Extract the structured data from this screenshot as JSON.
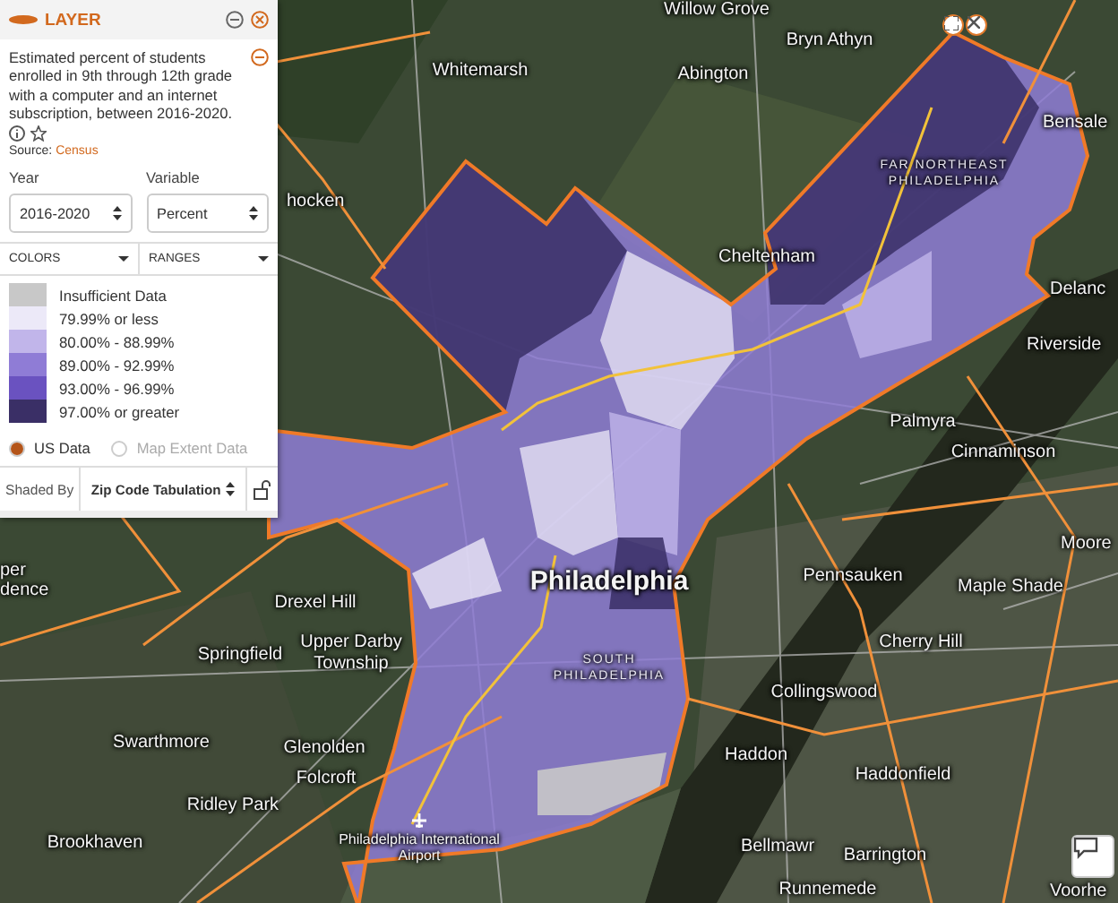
{
  "layer_panel": {
    "title": "LAYER",
    "description": "Estimated percent of students enrolled in 9th through 12th grade with a computer and an internet subscription, between 2016-2020.",
    "source_label": "Source:",
    "source_link": "Census",
    "year_label": "Year",
    "year_value": "2016-2020",
    "variable_label": "Variable",
    "variable_value": "Percent",
    "colors_menu": "COLORS",
    "ranges_menu": "RANGES",
    "legend": [
      {
        "label": "Insufficient Data",
        "color": "#c8c8c8"
      },
      {
        "label": "79.99% or less",
        "color": "#ece9f8"
      },
      {
        "label": "80.00% - 88.99%",
        "color": "#c1b5ea"
      },
      {
        "label": "89.00% - 92.99%",
        "color": "#8f7cd6"
      },
      {
        "label": "93.00% - 96.99%",
        "color": "#6a52c0"
      },
      {
        "label": "97.00% or greater",
        "color": "#3a2f66"
      }
    ],
    "data_options": [
      {
        "label": "US Data",
        "selected": true
      },
      {
        "label": "Map Extent Data",
        "selected": false
      }
    ],
    "shaded_by_label": "Shaded By",
    "shaded_by_value": "Zip Code Tabulation"
  },
  "map": {
    "labels": [
      {
        "text": "Willow Grove",
        "kind": "place"
      },
      {
        "text": "Bryn Athyn",
        "kind": "place"
      },
      {
        "text": "Whitemarsh",
        "kind": "place"
      },
      {
        "text": "Abington",
        "kind": "place"
      },
      {
        "text": "Bensale",
        "kind": "place"
      },
      {
        "text": "FAR NORTHEAST PHILADELPHIA",
        "kind": "district"
      },
      {
        "text": "hocken",
        "kind": "place"
      },
      {
        "text": "Cheltenham",
        "kind": "place"
      },
      {
        "text": "Delanc",
        "kind": "place"
      },
      {
        "text": "Riverside",
        "kind": "place"
      },
      {
        "text": "Palmyra",
        "kind": "place"
      },
      {
        "text": "Cinnaminson",
        "kind": "place"
      },
      {
        "text": "Moore",
        "kind": "place"
      },
      {
        "text": "per",
        "kind": "place"
      },
      {
        "text": "dence",
        "kind": "place"
      },
      {
        "text": "Philadelphia",
        "kind": "city"
      },
      {
        "text": "Pennsauken",
        "kind": "place"
      },
      {
        "text": "Maple Shade",
        "kind": "place"
      },
      {
        "text": "Drexel Hill",
        "kind": "place"
      },
      {
        "text": "Cherry Hill",
        "kind": "place"
      },
      {
        "text": "Springfield",
        "kind": "place"
      },
      {
        "text": "Upper Darby Township",
        "kind": "place"
      },
      {
        "text": "SOUTH PHILADELPHIA",
        "kind": "district"
      },
      {
        "text": "Collingswood",
        "kind": "place"
      },
      {
        "text": "Swarthmore",
        "kind": "place"
      },
      {
        "text": "Glenolden",
        "kind": "place"
      },
      {
        "text": "Haddon",
        "kind": "place"
      },
      {
        "text": "Haddonfield",
        "kind": "place"
      },
      {
        "text": "Folcroft",
        "kind": "place"
      },
      {
        "text": "Ridley Park",
        "kind": "place"
      },
      {
        "text": "Brookhaven",
        "kind": "place"
      },
      {
        "text": "Philadelphia International Airport",
        "kind": "poi"
      },
      {
        "text": "Bellmawr",
        "kind": "place"
      },
      {
        "text": "Barrington",
        "kind": "place"
      },
      {
        "text": "Runnemede",
        "kind": "place"
      },
      {
        "text": "Voorhe",
        "kind": "place"
      }
    ]
  }
}
